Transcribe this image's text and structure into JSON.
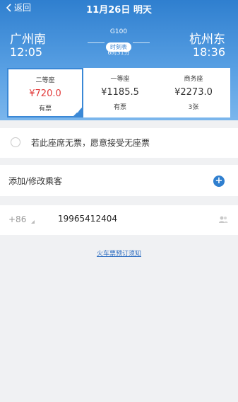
{
  "header": {
    "back_label": "返回",
    "date_title": "11月26日 明天",
    "from_station": "广州南",
    "from_time": "12:05",
    "to_station": "杭州东",
    "to_time": "18:36",
    "train_no": "G100",
    "timetable_label": "时刻表",
    "duration": "6时31分"
  },
  "seats": [
    {
      "name": "二等座",
      "price": "¥720.0",
      "availability": "有票",
      "selected": true
    },
    {
      "name": "一等座",
      "price": "¥1185.5",
      "availability": "有票",
      "selected": false
    },
    {
      "name": "商务座",
      "price": "¥2273.0",
      "availability": "3张",
      "selected": false
    }
  ],
  "options": {
    "no_seat_text": "若此座席无票，愿意接受无座票"
  },
  "passenger": {
    "label": "添加/修改乘客"
  },
  "contact": {
    "country_code": "+86",
    "phone": "19965412404"
  },
  "notice": {
    "link_text": "火车票预订须知"
  },
  "colors": {
    "primary": "#2f7fcf",
    "price_red": "#e23b3b",
    "background": "#f0f1f3"
  }
}
